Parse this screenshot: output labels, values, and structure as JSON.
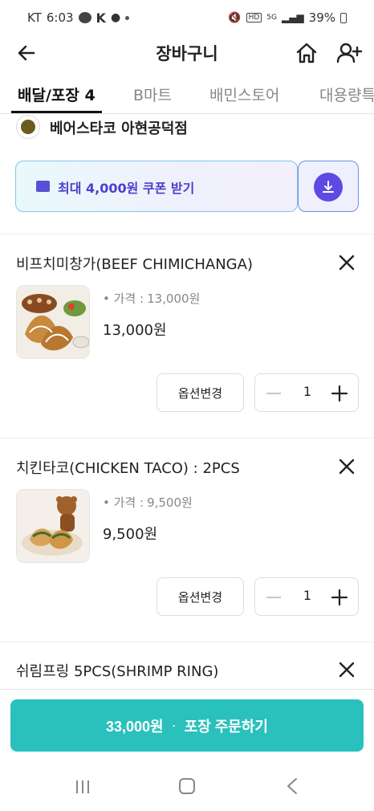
{
  "status_bar": {
    "carrier": "KT",
    "time": "6:03",
    "network": "5G",
    "battery": "39%"
  },
  "header": {
    "title": "장바구니"
  },
  "tabs": [
    {
      "label": "배달/포장 4",
      "active": true
    },
    {
      "label": "B마트",
      "active": false
    },
    {
      "label": "배민스토어",
      "active": false
    },
    {
      "label": "대용량특",
      "active": false
    }
  ],
  "store": {
    "name": "베어스타코 아현공덕점"
  },
  "coupon": {
    "label": "최대 4,000원 쿠폰 받기"
  },
  "items": [
    {
      "name": "비프치미창가(BEEF CHIMICHANGA)",
      "price_label": "가격 :",
      "price_detail": "13,000원",
      "total": "13,000원",
      "option_button": "옵션변경",
      "quantity": "1"
    },
    {
      "name": "치킨타코(CHICKEN TACO) : 2PCS",
      "price_label": "가격 :",
      "price_detail": "9,500원",
      "total": "9,500원",
      "option_button": "옵션변경",
      "quantity": "1"
    },
    {
      "name": "쉬림프링 5PCS(SHRIMP RING)"
    }
  ],
  "order_button": {
    "amount": "33,000원",
    "separator": "·",
    "action": "포장 주문하기"
  },
  "colors": {
    "accent": "#2ac1bc",
    "coupon_text": "#4b3fc9",
    "coupon_button": "#5e4ae3"
  }
}
